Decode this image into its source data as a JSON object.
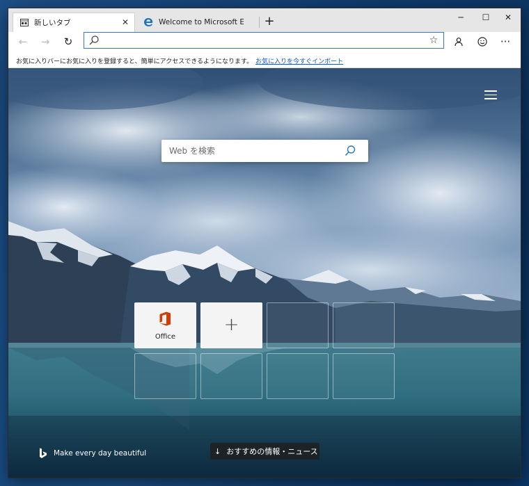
{
  "window": {
    "controls": {
      "minimize": "─",
      "maximize": "☐",
      "close": "✕"
    }
  },
  "tabs": [
    {
      "title": "新しいタブ",
      "icon": "newtab-icon",
      "active": true
    },
    {
      "title": "Welcome to Microsoft Edge Dev",
      "icon": "edge-logo-icon",
      "active": false
    }
  ],
  "toolbar": {
    "back": "←",
    "forward": "→",
    "refresh": "↻",
    "address_value": "",
    "address_placeholder": "",
    "favorite_star": "☆",
    "profile": "person-icon",
    "feedback": "smiley-icon",
    "more": "···"
  },
  "favorites_bar": {
    "message": "お気に入りバーにお気に入りを登録すると、簡単にアクセスできるようになります。",
    "link": "お気に入りを今すぐインポート"
  },
  "newtab": {
    "search_placeholder": "Web を検索",
    "tiles": [
      {
        "label": "Office",
        "type": "site",
        "icon": "office-icon"
      },
      {
        "label": "",
        "type": "add",
        "icon": "plus-icon",
        "glyph": "+"
      },
      {
        "label": "",
        "type": "empty"
      },
      {
        "label": "",
        "type": "empty"
      },
      {
        "label": "",
        "type": "empty"
      },
      {
        "label": "",
        "type": "empty"
      },
      {
        "label": "",
        "type": "empty"
      },
      {
        "label": "",
        "type": "empty"
      }
    ],
    "bing_credit": "Make every day beautiful",
    "news_button": "おすすめの情報・ニュース",
    "news_arrow": "↓"
  },
  "colors": {
    "accent": "#3a78c4",
    "link": "#0a5bc2",
    "office": "#d83b01"
  }
}
